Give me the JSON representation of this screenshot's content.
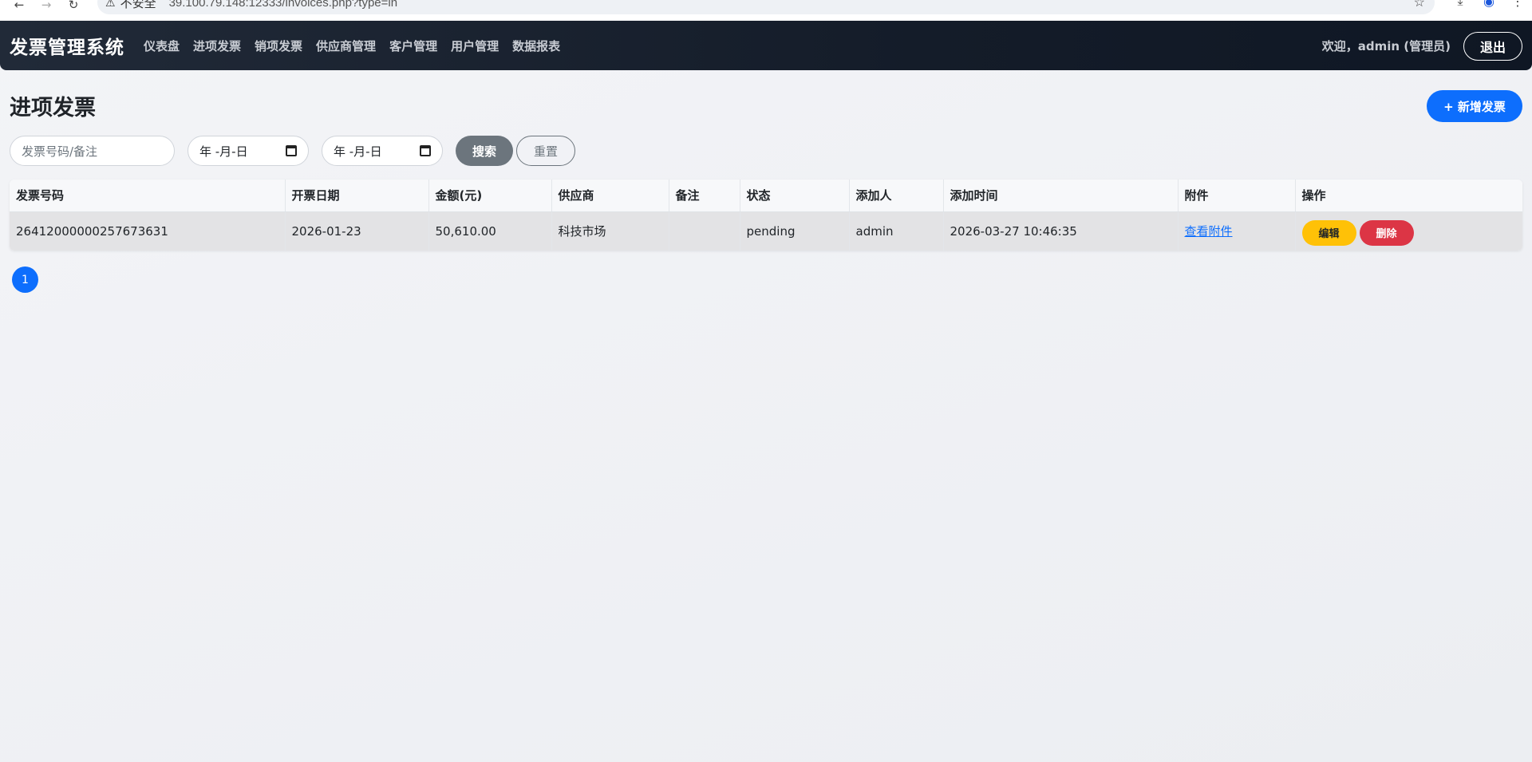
{
  "browser": {
    "insecure_label": "不安全",
    "url": "39.100.79.148:12333/invoices.php?type=in"
  },
  "nav": {
    "brand": "发票管理系统",
    "items": [
      "仪表盘",
      "进项发票",
      "销项发票",
      "供应商管理",
      "客户管理",
      "用户管理",
      "数据报表"
    ],
    "welcome": "欢迎，admin (管理员)",
    "logout": "退出"
  },
  "page": {
    "title": "进项发票",
    "add_button": "+ 新增发票"
  },
  "filters": {
    "search_placeholder": "发票号码/备注",
    "date_start": "年 -月-日",
    "date_end": "年 -月-日",
    "search_button": "搜索",
    "reset_button": "重置"
  },
  "table": {
    "headers": [
      "发票号码",
      "开票日期",
      "金额(元)",
      "供应商",
      "备注",
      "状态",
      "添加人",
      "添加时间",
      "附件",
      "操作"
    ],
    "rows": [
      {
        "invoice_no": "26412000000257673631",
        "date": "2026-01-23",
        "amount": "50,610.00",
        "supplier": "科技市场",
        "note": "",
        "status": "pending",
        "added_by": "admin",
        "added_at": "2026-03-27 10:46:35",
        "attachment": "查看附件",
        "edit": "编辑",
        "delete": "删除"
      }
    ]
  },
  "pagination": {
    "current": "1"
  }
}
